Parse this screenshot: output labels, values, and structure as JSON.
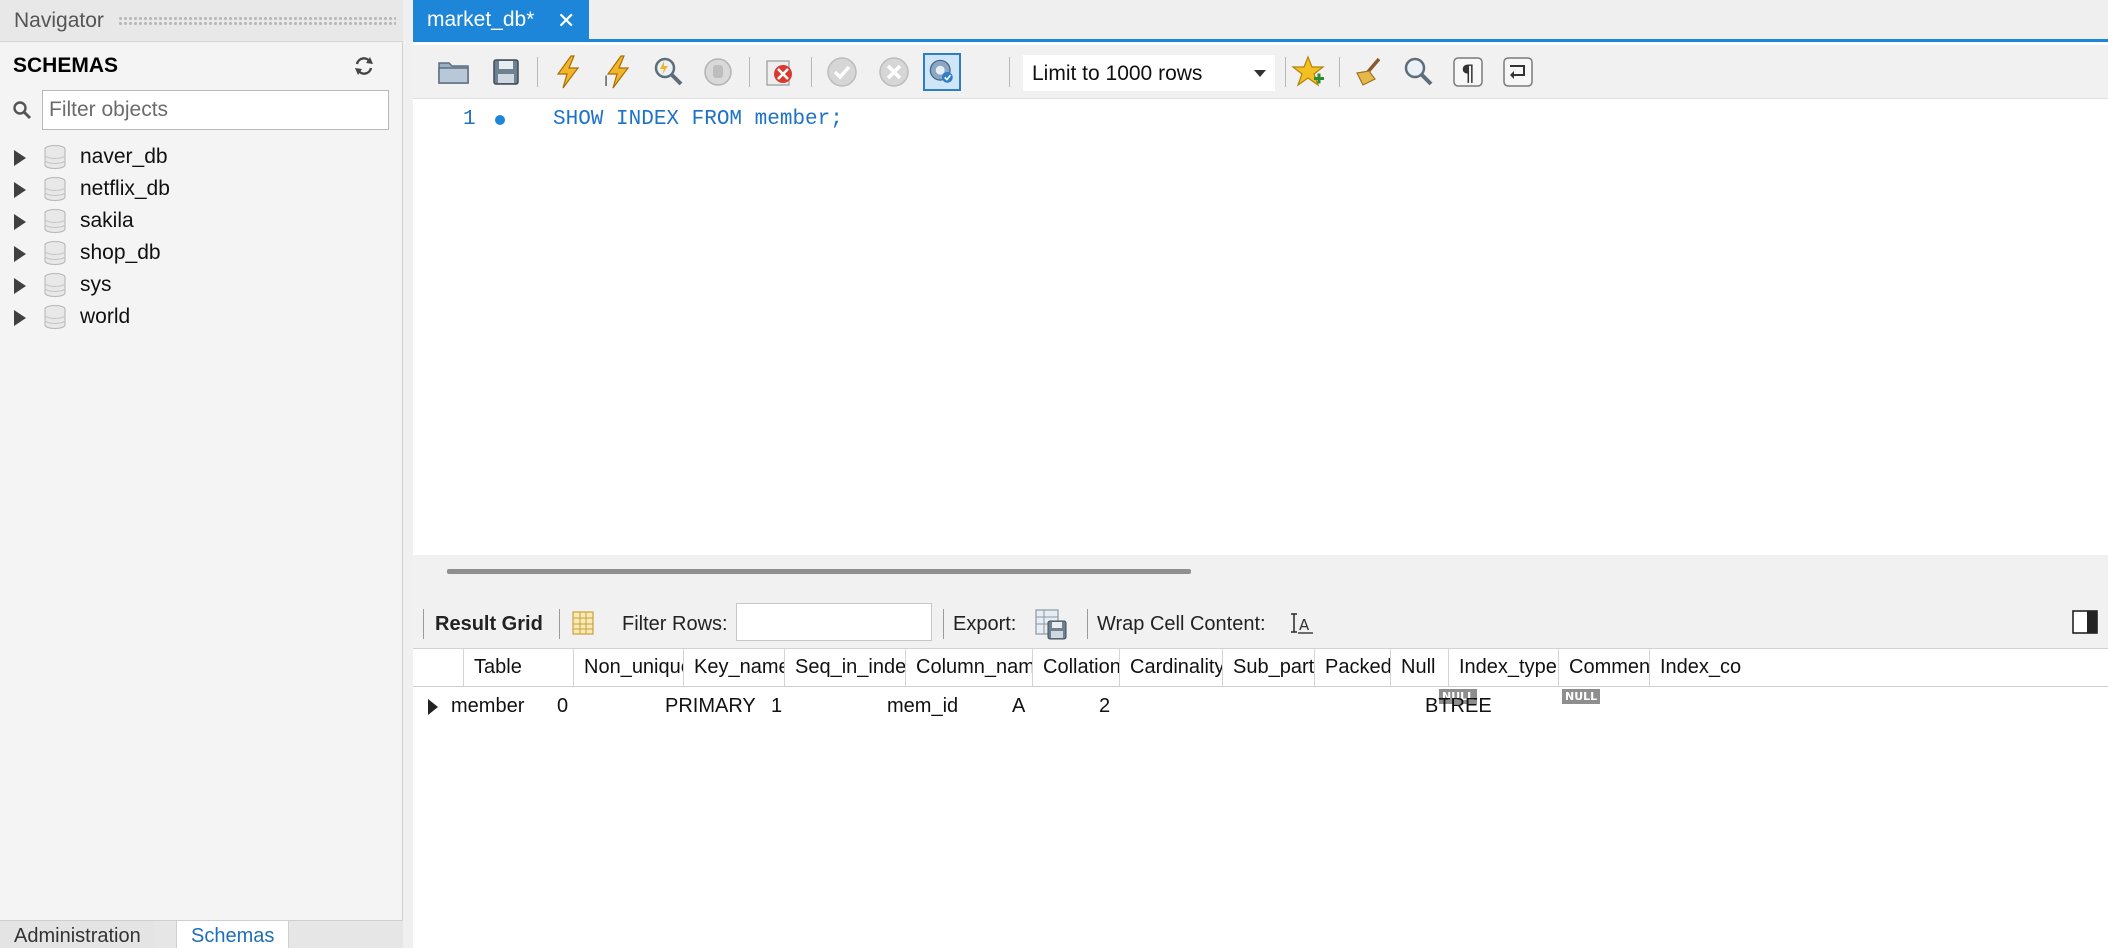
{
  "navigator": {
    "title": "Navigator",
    "schemas_label": "SCHEMAS",
    "filter_placeholder": "Filter objects",
    "schemas": [
      "naver_db",
      "netflix_db",
      "sakila",
      "shop_db",
      "sys",
      "world"
    ],
    "tabs": [
      "Administration",
      "Schemas"
    ],
    "active_tab": "Schemas"
  },
  "editor": {
    "tab_title": "market_db*",
    "limit_option": "Limit to 1000 rows",
    "line_number": "1",
    "sql": "SHOW INDEX FROM member;"
  },
  "result_toolbar": {
    "result_grid": "Result Grid",
    "filter_rows": "Filter Rows:",
    "export": "Export:",
    "wrap_cell": "Wrap Cell Content:"
  },
  "grid": {
    "columns": [
      "Table",
      "Non_unique",
      "Key_name",
      "Seq_in_index",
      "Column_name",
      "Collation",
      "Cardinality",
      "Sub_part",
      "Packed",
      "Null",
      "Index_type",
      "Comment",
      "Index_co"
    ],
    "rows": [
      [
        "member",
        "0",
        "PRIMARY",
        "1",
        "mem_id",
        "A",
        "2",
        "NULL",
        "NULL",
        "",
        "BTREE",
        "",
        ""
      ]
    ]
  },
  "colors": {
    "accent": "#1d86d8",
    "sql_keyword": "#1e72c8"
  },
  "icons": {
    "toolbar": [
      "open-file-icon",
      "save-icon",
      "execute-icon",
      "execute-current-icon",
      "explain-icon",
      "stop-icon",
      "toggle-error-stop-icon",
      "commit-icon",
      "rollback-icon",
      "autocommit-icon",
      "add-snippet-icon",
      "beautify-icon",
      "find-icon",
      "invisible-chars-icon",
      "word-wrap-icon"
    ]
  }
}
